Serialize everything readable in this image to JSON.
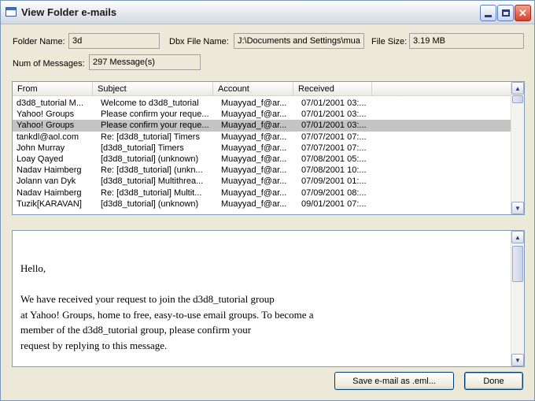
{
  "window": {
    "title": "View Folder e-mails"
  },
  "fields": {
    "folder_name_label": "Folder Name:",
    "folder_name_value": "3d",
    "dbx_label": "Dbx File Name:",
    "dbx_value": "J:\\Documents and Settings\\mua",
    "size_label": "File Size:",
    "size_value": "3.19 MB",
    "count_label": "Num of Messages:",
    "count_value": "297 Message(s)"
  },
  "list": {
    "columns": [
      "From",
      "Subject",
      "Account",
      "Received"
    ],
    "rows": [
      [
        "d3d8_tutorial M...",
        "Welcome to d3d8_tutorial",
        "Muayyad_f@ar...",
        "07/01/2001 03:..."
      ],
      [
        "Yahoo! Groups",
        "Please confirm your reque...",
        "Muayyad_f@ar...",
        "07/01/2001 03:..."
      ],
      [
        "Yahoo! Groups",
        "Please confirm your reque...",
        "Muayyad_f@ar...",
        "07/01/2001 03:..."
      ],
      [
        "tankdl@aol.com",
        "Re: [d3d8_tutorial] Timers",
        "Muayyad_f@ar...",
        "07/07/2001 07:..."
      ],
      [
        "John Murray",
        "[d3d8_tutorial] Timers",
        "Muayyad_f@ar...",
        "07/07/2001 07:..."
      ],
      [
        "Loay Qayed",
        "[d3d8_tutorial] (unknown)",
        "Muayyad_f@ar...",
        "07/08/2001 05:..."
      ],
      [
        "Nadav Haimberg",
        "Re: [d3d8_tutorial] (unkn...",
        "Muayyad_f@ar...",
        "07/08/2001 10:..."
      ],
      [
        "Jolann van Dyk",
        "[d3d8_tutorial] Multithrea...",
        "Muayyad_f@ar...",
        "07/09/2001 01:..."
      ],
      [
        "Nadav Haimberg",
        "Re: [d3d8_tutorial] Multit...",
        "Muayyad_f@ar...",
        "07/09/2001 08:..."
      ],
      [
        "Tuzik[KARAVAN]",
        "[d3d8_tutorial] (unknown)",
        "Muayyad_f@ar...",
        "09/01/2001 07:..."
      ]
    ],
    "selected_row": 2
  },
  "preview": {
    "lines": [
      "Hello,",
      "",
      "We have received your request to join the d3d8_tutorial group",
      "at Yahoo! Groups, home to free, easy-to-use email groups.  To become a",
      "member of the d3d8_tutorial group, please confirm your",
      "request by replying to this message."
    ]
  },
  "buttons": {
    "save_label": "Save e-mail as .eml...",
    "done_label": "Done"
  }
}
